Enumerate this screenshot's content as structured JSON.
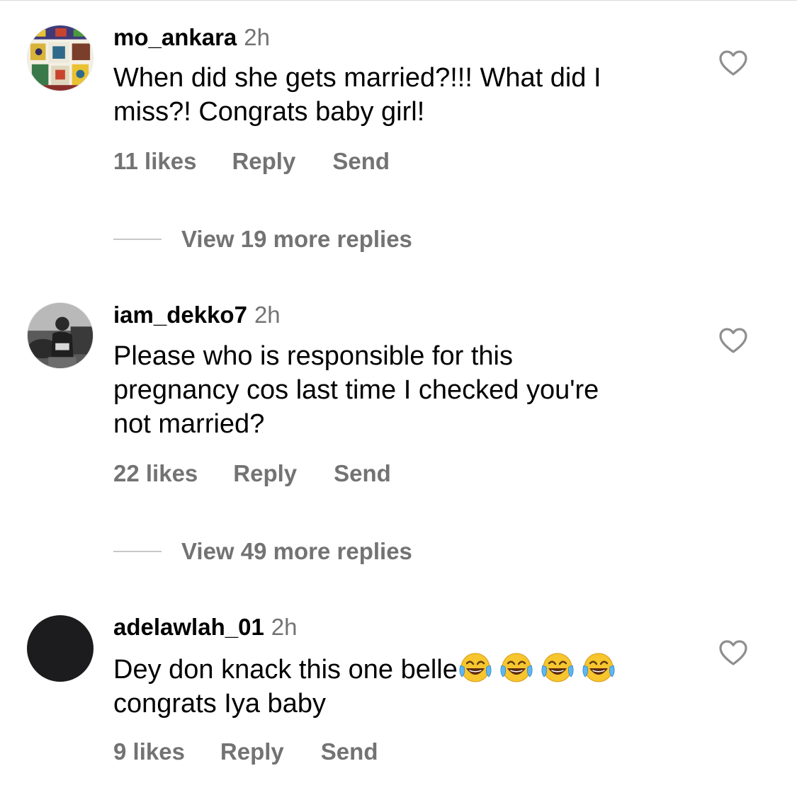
{
  "comments": [
    {
      "username": "mo_ankara",
      "time": "2h",
      "text": "When did she gets married?!!! What did I miss?! Congrats baby girl!",
      "text_lines": [
        "When did she gets married?!!! What did I",
        "miss?! Congrats baby girl!"
      ],
      "likes": "11 likes",
      "reply": "Reply",
      "send": "Send",
      "view_replies": "View 19 more replies",
      "avatar_icon": "ankara-fabric-avatar"
    },
    {
      "username": "iam_dekko7",
      "time": "2h",
      "text_lines": [
        "Please who is responsible for this",
        "pregnancy cos last time I checked you're",
        "not married?"
      ],
      "likes": "22 likes",
      "reply": "Reply",
      "send": "Send",
      "view_replies": "View 49 more replies",
      "avatar_icon": "photo-avatar"
    },
    {
      "username": "adelawlah_01",
      "time": "2h",
      "text_lines": [
        "Dey don knack this one belle",
        "congrats Iya baby"
      ],
      "emojis": [
        "face-with-tears-of-joy",
        "face-with-tears-of-joy",
        "face-with-tears-of-joy",
        "face-with-tears-of-joy"
      ],
      "likes": "9 likes",
      "reply": "Reply",
      "send": "Send",
      "avatar_icon": "dark-avatar"
    }
  ],
  "icons": {
    "like": "heart-outline-icon"
  },
  "colors": {
    "text": "#000000",
    "secondary": "#737373",
    "divider": "#c7c7c7",
    "dark_avatar": "#1c1c1e"
  }
}
